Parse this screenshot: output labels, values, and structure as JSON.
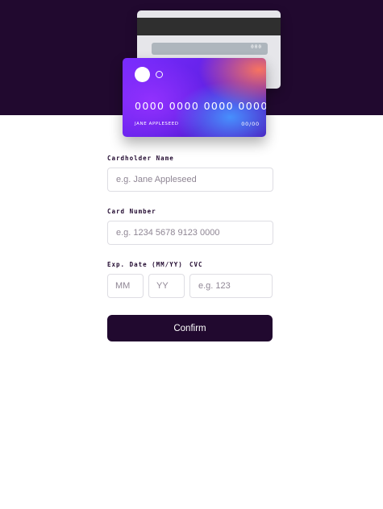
{
  "card": {
    "back_cvc": "000",
    "front_number": "0000 0000 0000 0000",
    "front_holder": "JANE APPLESEED",
    "front_exp_month": "00",
    "front_exp_sep": "/",
    "front_exp_year": "00"
  },
  "form": {
    "name_label": "Cardholder Name",
    "name_placeholder": "e.g. Jane Appleseed",
    "number_label": "Card Number",
    "number_placeholder": "e.g. 1234 5678 9123 0000",
    "exp_label": "Exp. Date (MM/YY)",
    "mm_placeholder": "MM",
    "yy_placeholder": "YY",
    "cvc_label": "CVC",
    "cvc_placeholder": "e.g. 123",
    "confirm_label": "Confirm"
  },
  "colors": {
    "header_bg": "#21092f",
    "button_bg": "#21092f",
    "input_border": "#dedde3"
  }
}
